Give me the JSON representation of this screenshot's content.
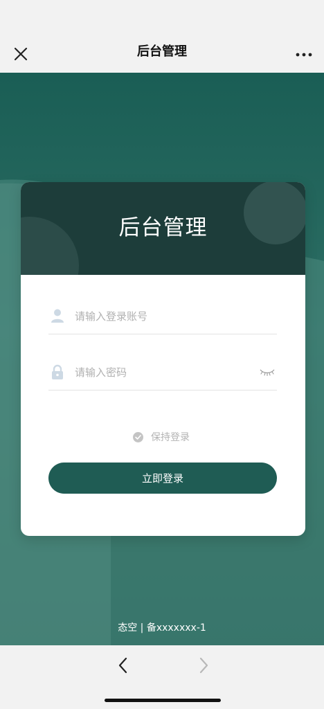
{
  "nav": {
    "title": "后台管理",
    "close_icon": "close-icon",
    "more_icon": "more-icon"
  },
  "card": {
    "title": "后台管理",
    "username": {
      "placeholder": "请输入登录账号",
      "value": "",
      "icon": "user-icon"
    },
    "password": {
      "placeholder": "请输入密码",
      "value": "",
      "icon": "lock-icon",
      "toggle_icon": "eye-closed-icon"
    },
    "remember": {
      "label": "保持登录",
      "icon": "check-circle-icon"
    },
    "login_button": "立即登录"
  },
  "footer": {
    "text": "态空 | 备xxxxxxx-1"
  },
  "bottom_bar": {
    "back_icon": "chevron-left-icon",
    "forward_icon": "chevron-right-icon"
  },
  "colors": {
    "accent": "#1f5c54",
    "card_header": "#1d3d3a",
    "background": "#2d6e64"
  }
}
